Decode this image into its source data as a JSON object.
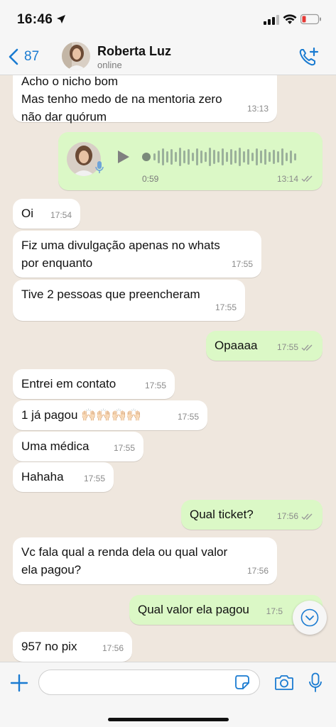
{
  "status_bar": {
    "time": "16:46"
  },
  "header": {
    "back_count": "87",
    "contact_name": "Roberta Luz",
    "contact_status": "online"
  },
  "messages": [
    {
      "dir": "in",
      "text": "Acho o nicho bom\nMas tenho medo de na mentoria zero\nnão dar quórum",
      "time": "13:13"
    },
    {
      "dir": "out",
      "type": "audio",
      "duration": "0:59",
      "time": "13:14"
    },
    {
      "dir": "in",
      "text": "Oi",
      "time": "17:54"
    },
    {
      "dir": "in",
      "text": "Fiz uma divulgação apenas no whats\npor enquanto",
      "time": "17:55"
    },
    {
      "dir": "in",
      "text": "Tive 2 pessoas que preencheram",
      "time": "17:55"
    },
    {
      "dir": "out",
      "text": "Opaaaa",
      "time": "17:55"
    },
    {
      "dir": "in",
      "text": "Entrei em contato",
      "time": "17:55"
    },
    {
      "dir": "in",
      "text": "1 já pagou 🙌🏻🙌🏻🙌🏻🙌🏻",
      "time": "17:55"
    },
    {
      "dir": "in",
      "text": "Uma médica",
      "time": "17:55"
    },
    {
      "dir": "in",
      "text": "Hahaha",
      "time": "17:55"
    },
    {
      "dir": "out",
      "text": "Qual ticket?",
      "time": "17:56"
    },
    {
      "dir": "in",
      "text": "Vc fala qual a renda dela ou qual valor\nela pagou?",
      "time": "17:56"
    },
    {
      "dir": "out",
      "text": "Qual valor ela pagou",
      "time": "17:5"
    },
    {
      "dir": "in",
      "text": "957 no pix",
      "time": "17:56"
    }
  ],
  "input": {
    "placeholder": ""
  },
  "colors": {
    "accent": "#1a7bd1",
    "outgoing_bubble": "#dbf8c6",
    "incoming_bubble": "#ffffff",
    "chat_bg": "#efe7de"
  },
  "icons": [
    "location-arrow-icon",
    "signal-icon",
    "wifi-icon",
    "battery-icon",
    "back-chevron-icon",
    "add-call-icon",
    "play-icon",
    "mic-icon",
    "double-check-icon",
    "chevron-down-icon",
    "plus-icon",
    "sticker-icon",
    "camera-icon",
    "microphone-icon"
  ]
}
